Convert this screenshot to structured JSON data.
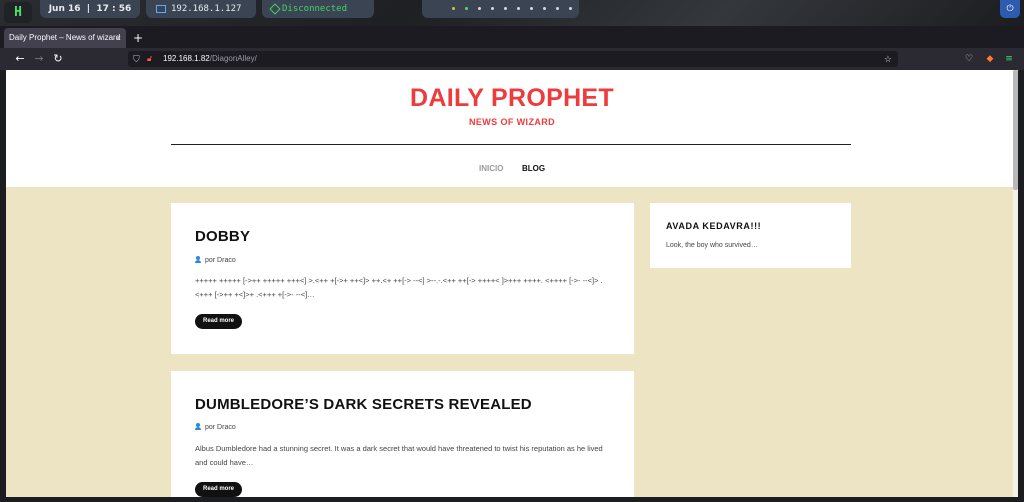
{
  "panel": {
    "logo": "H",
    "date": "Jun 16",
    "time": "17 : 56",
    "ip": "192.168.1.127",
    "vpn_status": "Disconnected"
  },
  "browser": {
    "tab_title": "Daily Prophet – News of wizard",
    "tab_close": "×",
    "new_tab": "+",
    "url_host": "192.168.1.82",
    "url_path": "/DiagonAlley/"
  },
  "site": {
    "title": "DAILY PROPHET",
    "tagline": "NEWS OF WIZARD",
    "menu": [
      "INICIO",
      "BLOG"
    ]
  },
  "posts": [
    {
      "title": "DOBBY",
      "author": "por Draco",
      "excerpt": "+++++ +++++ [->++ +++++ +++<] >.<++ +[->+ ++<]> ++.<+ ++[-> --<] >--.-.<++ ++[-> ++++< ]>+++ ++++. <++++ [->- --<]> .<+++ [->++ +<]>+ .<+++ +[->- --<]…",
      "read_more": "Read more"
    },
    {
      "title": "DUMBLEDORE’S DARK SECRETS REVEALED",
      "author": "por Draco",
      "excerpt": "Albus Dumbledore had a stunning secret. It was a dark secret that would have threatened to twist his reputation as he lived and could have…",
      "read_more": "Read more"
    }
  ],
  "sidebar": {
    "title": "AVADA KEDAVRA!!!",
    "text": "Look, the boy who survived…"
  },
  "colors": {
    "brand_red": "#ee3b3b",
    "page_bg": "#ede4c4",
    "author_icon": "#2f87d9"
  }
}
